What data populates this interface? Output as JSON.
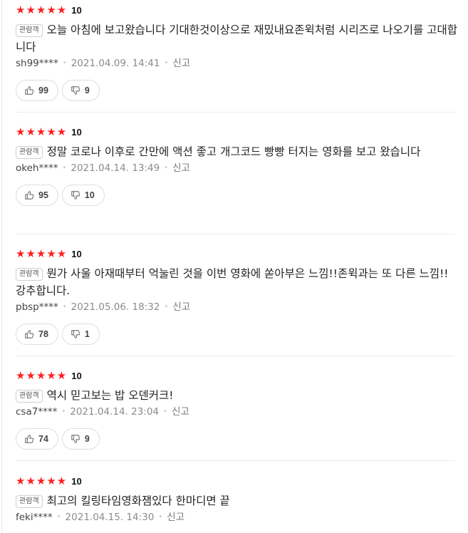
{
  "reviews": [
    {
      "stars": "★★★★★",
      "score": "10",
      "badge": "관람객",
      "text": "오늘 아침에 보고왔습니다 기대한것이상으로 재밌내요존윅처럼 시리즈로 나오기를 고대합니다",
      "user": "sh99****",
      "date": "2021.04.09. 14:41",
      "report": "신고",
      "likes": "99",
      "dislikes": "9"
    },
    {
      "stars": "★★★★★",
      "score": "10",
      "badge": "관람객",
      "text": "정말 코로나 이후로 간만에 액션 좋고 개그코드 빵빵 터지는 영화를 보고 왔습니다",
      "user": "okeh****",
      "date": "2021.04.14. 13:49",
      "report": "신고",
      "likes": "95",
      "dislikes": "10"
    },
    {
      "stars": "★★★★★",
      "score": "10",
      "badge": "관람객",
      "text": "뭔가 사울 아재때부터 억눌린 것을 이번 영화에 쏟아부은 느낌!!존윅과는 또 다른 느낌!!강추합니다.",
      "user": "pbsp****",
      "date": "2021.05.06. 18:32",
      "report": "신고",
      "likes": "78",
      "dislikes": "1"
    },
    {
      "stars": "★★★★★",
      "score": "10",
      "badge": "관람객",
      "text": "역시 믿고보는 밥 오덴커크!",
      "user": "csa7****",
      "date": "2021.04.14. 23:04",
      "report": "신고",
      "likes": "74",
      "dislikes": "9"
    },
    {
      "stars": "★★★★★",
      "score": "10",
      "badge": "관람객",
      "text": "최고의 킬링타임영화잼있다 한마디면 끝",
      "user": "feki****",
      "date": "2021.04.15. 14:30",
      "report": "신고"
    }
  ],
  "colors": {
    "star": "#ff1f1f",
    "meta": "#8b8b8b",
    "border": "#dedede"
  },
  "icons": {
    "like": "thumbs-up-icon",
    "dislike": "thumbs-down-icon"
  }
}
